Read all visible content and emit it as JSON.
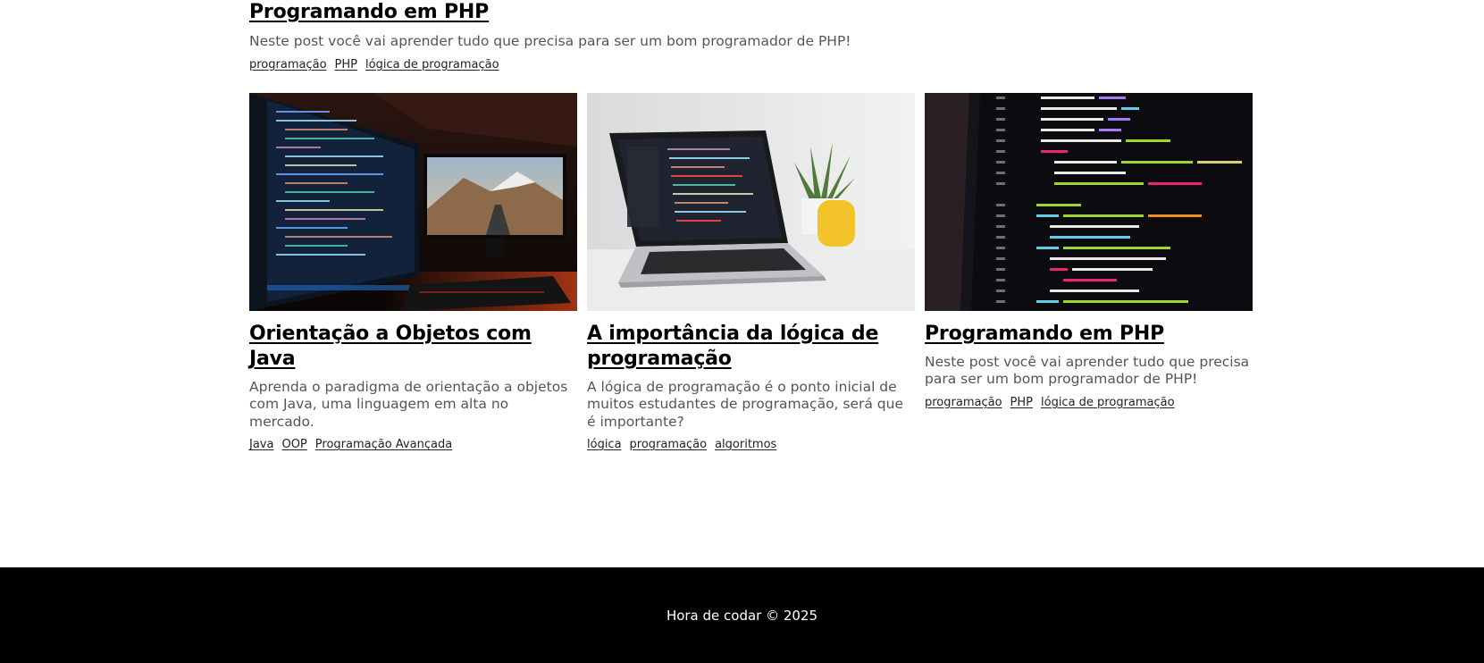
{
  "featured": {
    "title": "Programando em PHP",
    "description": "Neste post você vai aprender tudo que precisa para ser um bom programador de PHP!",
    "tags": [
      "programação",
      "PHP",
      "lógica de programação"
    ]
  },
  "cards": [
    {
      "title": "Orientação a Objetos com Java",
      "description": "Aprenda o paradigma de orientação a objetos com Java, uma linguagem em alta no mercado.",
      "tags": [
        "Java",
        "OOP",
        "Programação Avançada"
      ]
    },
    {
      "title": "A importância da lógica de programação",
      "description": "A lógica de programação é o ponto inicial de muitos estudantes de programação, será que é importante?",
      "tags": [
        "lógica",
        "programação",
        "algoritmos"
      ]
    },
    {
      "title": "Programando em PHP",
      "description": "Neste post você vai aprender tudo que precisa para ser um bom programador de PHP!",
      "tags": [
        "programação",
        "PHP",
        "lógica de programação"
      ]
    }
  ],
  "footer": {
    "text": "Hora de codar © 2025"
  }
}
